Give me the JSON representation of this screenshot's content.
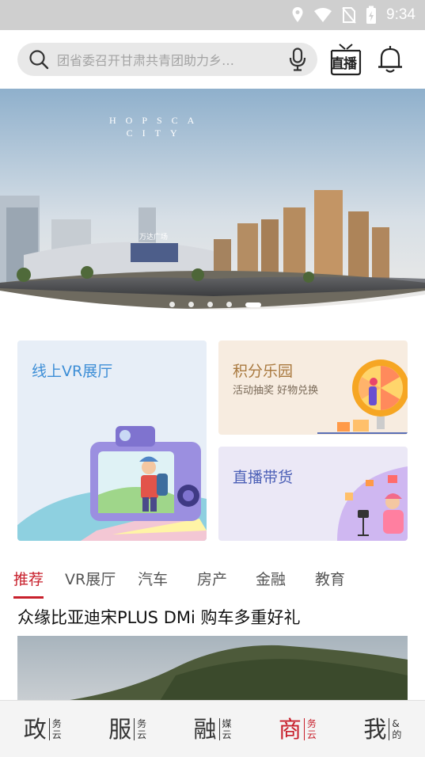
{
  "status_bar": {
    "time": "9:34",
    "icons": [
      "location-icon",
      "wifi-icon",
      "no-sim-icon",
      "battery-charging-icon"
    ]
  },
  "search": {
    "placeholder": "团省委召开甘肃共青团助力乡…",
    "left_icon": "search-icon",
    "right_icon": "microphone-icon"
  },
  "header_actions": {
    "live_label": "直播",
    "live_icon": "tv-icon",
    "notify_icon": "bell-icon"
  },
  "banner": {
    "caption_line1": "HOPSCA",
    "caption_line2": "CITY",
    "sign_text": "万达广场",
    "slide_count": 5,
    "active_slide": 5
  },
  "cards": {
    "vr_hall": {
      "title": "线上VR展厅",
      "title_color": "#3d8ed6"
    },
    "points_park": {
      "title": "积分乐园",
      "subtitle": "活动抽奖 好物兑换",
      "title_color": "#a9793f"
    },
    "live_sales": {
      "title": "直播带货",
      "title_color": "#4b5fb6"
    }
  },
  "category_tabs": [
    {
      "label": "推荐",
      "active": true
    },
    {
      "label": "VR展厅",
      "active": false
    },
    {
      "label": "汽车",
      "active": false
    },
    {
      "label": "房产",
      "active": false
    },
    {
      "label": "金融",
      "active": false
    },
    {
      "label": "教育",
      "active": false
    }
  ],
  "article": {
    "title": "众缘比亚迪宋PLUS DMi 购车多重好礼"
  },
  "bottom_nav": [
    {
      "main": "政",
      "sub1": "务",
      "sub2": "云",
      "active": false
    },
    {
      "main": "服",
      "sub1": "务",
      "sub2": "云",
      "active": false
    },
    {
      "main": "融",
      "sub1": "媒",
      "sub2": "云",
      "active": false
    },
    {
      "main": "商",
      "sub1": "务",
      "sub2": "云",
      "active": true
    },
    {
      "main": "我",
      "sub1": "&",
      "sub2": "的",
      "active": false
    }
  ],
  "colors": {
    "accent": "#c8202c",
    "status_bar": "#cfcfcf",
    "search_bg": "#e8e8e8"
  }
}
